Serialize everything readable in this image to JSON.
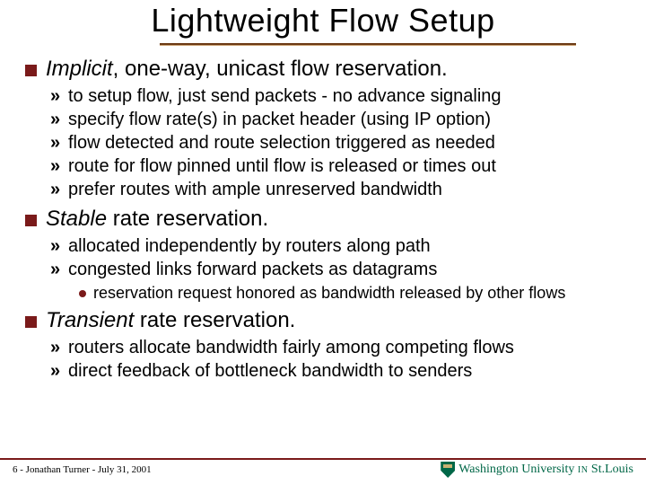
{
  "title": "Lightweight Flow Setup",
  "sections": [
    {
      "head_emph": "Implicit",
      "head_rest": ", one-way, unicast flow reservation.",
      "subs": [
        "to setup flow, just send packets - no advance signaling",
        "specify flow rate(s) in packet header (using IP option)",
        "flow detected and route selection triggered as needed",
        "route for flow pinned until flow is released or times out",
        "prefer routes with ample unreserved bandwidth"
      ],
      "subsubs": []
    },
    {
      "head_emph": "Stable",
      "head_rest": " rate reservation.",
      "subs": [
        "allocated independently by routers along path",
        "congested links forward packets as datagrams"
      ],
      "subsubs": [
        "reservation request honored as bandwidth released by other flows"
      ]
    },
    {
      "head_emph": "Transient",
      "head_rest": " rate reservation.",
      "subs": [
        "routers allocate bandwidth fairly among competing flows",
        "direct feedback of bottleneck bandwidth to senders"
      ],
      "subsubs": []
    }
  ],
  "footer": {
    "left": "6 - Jonathan Turner - July 31, 2001",
    "uni": "Washington University in St.Louis"
  }
}
